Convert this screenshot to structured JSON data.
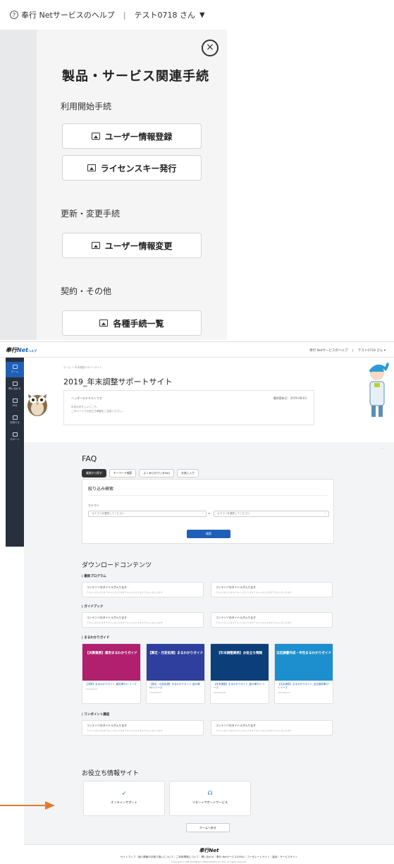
{
  "zoom": {
    "help_label": "奉行 Netサービスのヘルプ",
    "help_icon": "?",
    "user_label": "テスト0718 さん",
    "title": "製品・サービス関連手続",
    "close_icon": "×",
    "sections": [
      {
        "label": "利用開始手続",
        "buttons": [
          "ユーザー情報登録",
          "ライセンスキー発行"
        ]
      },
      {
        "label": "更新・変更手続",
        "buttons": [
          "ユーザー情報変更"
        ]
      },
      {
        "label": "契約・その他",
        "buttons": [
          "各種手続一覧"
        ]
      }
    ]
  },
  "page": {
    "logo_text": "奉行",
    "logo_net": "Net",
    "logo_suffix": "ヘルプ",
    "help_label": "奉行 Netサービスのヘルプ",
    "user_label": "テスト0718 さん",
    "sidebar": [
      {
        "label": "ホーム"
      },
      {
        "label": "問い合わせ"
      },
      {
        "label": "FAQ"
      },
      {
        "label": "お知らせ"
      },
      {
        "label": "サポート"
      }
    ],
    "breadcrumb": "ホーム ＞ 年末調整サポートサイト",
    "title": "2019_年末調整サポートサイト",
    "header_text": "ヘッダーのテキストです",
    "updated": "最終更新日：2019-09-03",
    "intro_line1": "年末のお忙しいところ、",
    "intro_line2": "このページでお役立ち情報をご活用ください。",
    "faq": {
      "title": "FAQ",
      "tabs": [
        "業務から探す",
        "キーワード検索",
        "よくみられているFAQ",
        "お気に入り"
      ],
      "filter_title": "絞り込み検索",
      "category_label": "カテゴリ",
      "select1": "カテゴリを選択してください",
      "select2": "カテゴリを選択してください",
      "search_button": "検索"
    },
    "downloads": {
      "title": "ダウンロードコンテンツ",
      "latest": "最新プログラム",
      "guidebook": "ガイドブック",
      "maruwakari": "まるわかりガイド",
      "onepoint": "ワンポイント講座",
      "card_title": "コンテンツのタイトルが入ります",
      "card_desc": "テキストが入りますテキストが入りますテキストが入りますテキストが入ります",
      "guides": [
        {
          "banner": "【決算業務】運用まるわかりガイド",
          "title": "【決算】まるわかりガイド_勘定奉行iシリーズ",
          "date": "2019/05/13",
          "color": "#b0206e"
        },
        {
          "banner": "【算定・月変処理】まるわかりガイド",
          "title": "【算定・月変処理】まるわかりガイド_給与奉行iシリーズ",
          "date": "2019/05/23",
          "color": "#2f3f9e"
        },
        {
          "banner": "【年末調整業務】お役立ち情報",
          "title": "【年末調整】まるわかりガイド_給与奉行iシリーズ",
          "date": "2019/09/16",
          "color": "#0c3f7a"
        },
        {
          "banner": "法定調書作成・申告まるわかりガイド",
          "title": "【法定調書】まるわかりガイド_法定調書奉行iシリーズ",
          "date": "2019/09/23",
          "color": "#1e8fce"
        }
      ]
    },
    "useful": {
      "title": "お役立ち情報サイト",
      "online": "オンラインサポート",
      "remote": "リモートサポートサービス"
    },
    "home_button": "ホームへ戻る",
    "footer_logo": "奉行Net",
    "footer_links": "サイトマップ｜個人情報のお取り扱いについて｜ご利用環境について｜問い合わせ｜奉行 NetサービスのFAQ｜コーポレートサイト｜製品・サービスサイト",
    "copyright": "Copyright(c) OBC BUSINESS CONSULTANTS CO.,LTD. All rights reserved."
  },
  "colors": {
    "accent": "#1f5fb8",
    "sidebar": "#27313d",
    "arrow": "#e07b2e"
  }
}
